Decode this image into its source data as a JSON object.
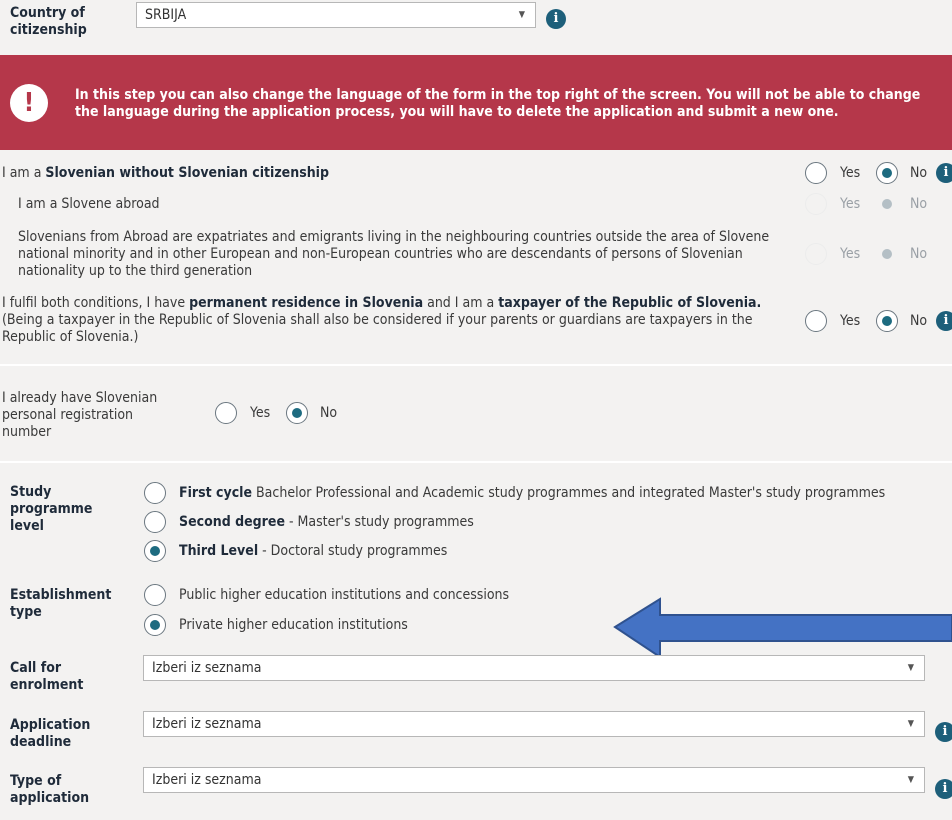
{
  "country": {
    "label": "Country of citizenship",
    "value": "SRBIJA"
  },
  "alert": {
    "text": "In this step you can also change the language of the form in the top right of the screen. You will not be able to change the language during the application process, you will have to delete the application and submit a new one."
  },
  "slovenian_without_citizenship": {
    "pre": "I am a ",
    "bold": "Slovenian without Slovenian citizenship",
    "yes": "Yes",
    "no": "No",
    "selected": "No"
  },
  "slovene_abroad": {
    "label": "I am a Slovene abroad",
    "yes": "Yes",
    "no": "No",
    "selected": "No"
  },
  "slovenians_from_abroad": {
    "label": "Slovenians from Abroad are expatriates and emigrants living in the neighbouring countries outside the area of Slovene national minority and in other European and non-European countries who are descendants of persons of Slovenian nationality up to the third generation",
    "yes": "Yes",
    "no": "No",
    "selected": "No"
  },
  "conditions": {
    "pre": "I fulfil both conditions, I have ",
    "bold1": "permanent residence in Slovenia",
    "mid": " and I am a ",
    "bold2": "taxpayer of the Republic of Slovenia.",
    "note": "(Being a taxpayer in the Republic of Slovenia shall also be considered if your parents or guardians are taxpayers in the Republic of Slovenia.)",
    "yes": "Yes",
    "no": "No",
    "selected": "No"
  },
  "registration": {
    "label": "I already have Slovenian personal registration number",
    "yes": "Yes",
    "no": "No",
    "selected": "No"
  },
  "study_level": {
    "label": "Study programme level",
    "options": [
      {
        "bold": "First cycle",
        "rest": " Bachelor Professional and Academic study programmes and integrated Master's study programmes",
        "checked": false
      },
      {
        "bold": "Second degree",
        "rest": " - Master's study programmes",
        "checked": false
      },
      {
        "bold": "Third Level",
        "rest": " - Doctoral study programmes",
        "checked": true
      }
    ]
  },
  "establishment": {
    "label": "Establishment type",
    "options": [
      {
        "text": "Public higher education institutions and concessions",
        "checked": false
      },
      {
        "text": "Private higher education institutions",
        "checked": true
      }
    ]
  },
  "call_for_enrolment": {
    "label": "Call for enrolment",
    "value": "Izberi iz seznama"
  },
  "application_deadline": {
    "label": "Application deadline",
    "value": "Izberi iz seznama"
  },
  "type_of_application": {
    "label": "Type of application",
    "value": "Izberi iz seznama"
  },
  "colors": {
    "alert": "#b5374a",
    "accent": "#1d6b80",
    "arrow_fill": "#4472c4",
    "arrow_stroke": "#2f528f"
  },
  "icons": {
    "info": "info-icon",
    "caret": "chevron-down-icon",
    "alert": "exclamation-icon",
    "arrow": "left-arrow-annotation"
  }
}
